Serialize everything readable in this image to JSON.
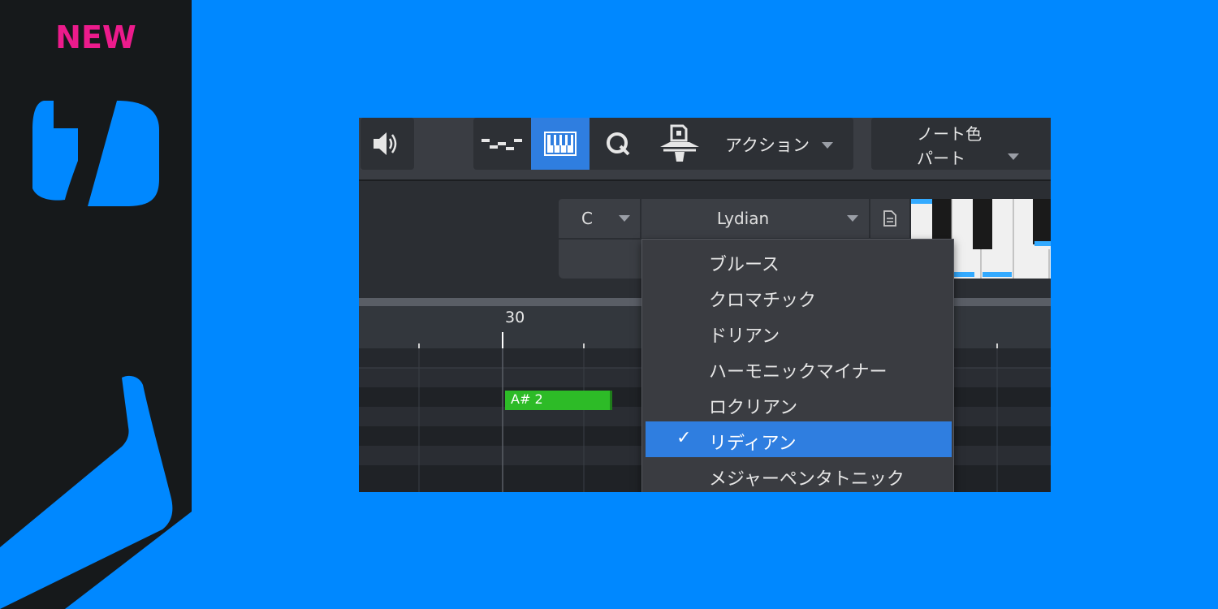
{
  "badge": {
    "text": "NEW"
  },
  "colors": {
    "background": "#0088ff",
    "brand_panel": "#16191b",
    "badge": "#ec1b8c",
    "accent": "#2f7ee0",
    "note": "#2dbb27"
  },
  "toolbar": {
    "speaker_icon": "speaker-icon",
    "tools": [
      {
        "name": "draw-line-tool",
        "icon": "step-line-icon",
        "active": false
      },
      {
        "name": "keyboard-tool",
        "icon": "piano-keyboard-icon",
        "active": true
      },
      {
        "name": "quantize-tool",
        "icon": "q-icon",
        "active": false
      },
      {
        "name": "scale-tool",
        "icon": "folder-scale-icon",
        "active": false
      }
    ],
    "action_label": "アクション",
    "note_color_line1": "ノート色",
    "note_color_line2": "パート"
  },
  "scale": {
    "key": "C",
    "mode": "Lydian",
    "doc_icon": "document-icon"
  },
  "ruler": {
    "bar_number": "30"
  },
  "note": {
    "label": "A# 2"
  },
  "dropdown": {
    "items": [
      {
        "label": "ブルース",
        "selected": false
      },
      {
        "label": "クロマチック",
        "selected": false
      },
      {
        "label": "ドリアン",
        "selected": false
      },
      {
        "label": "ハーモニックマイナー",
        "selected": false
      },
      {
        "label": "ロクリアン",
        "selected": false
      },
      {
        "label": "リディアン",
        "selected": true
      },
      {
        "label": "メジャーペンタトニック",
        "selected": false
      }
    ],
    "check_mark": "✓"
  }
}
